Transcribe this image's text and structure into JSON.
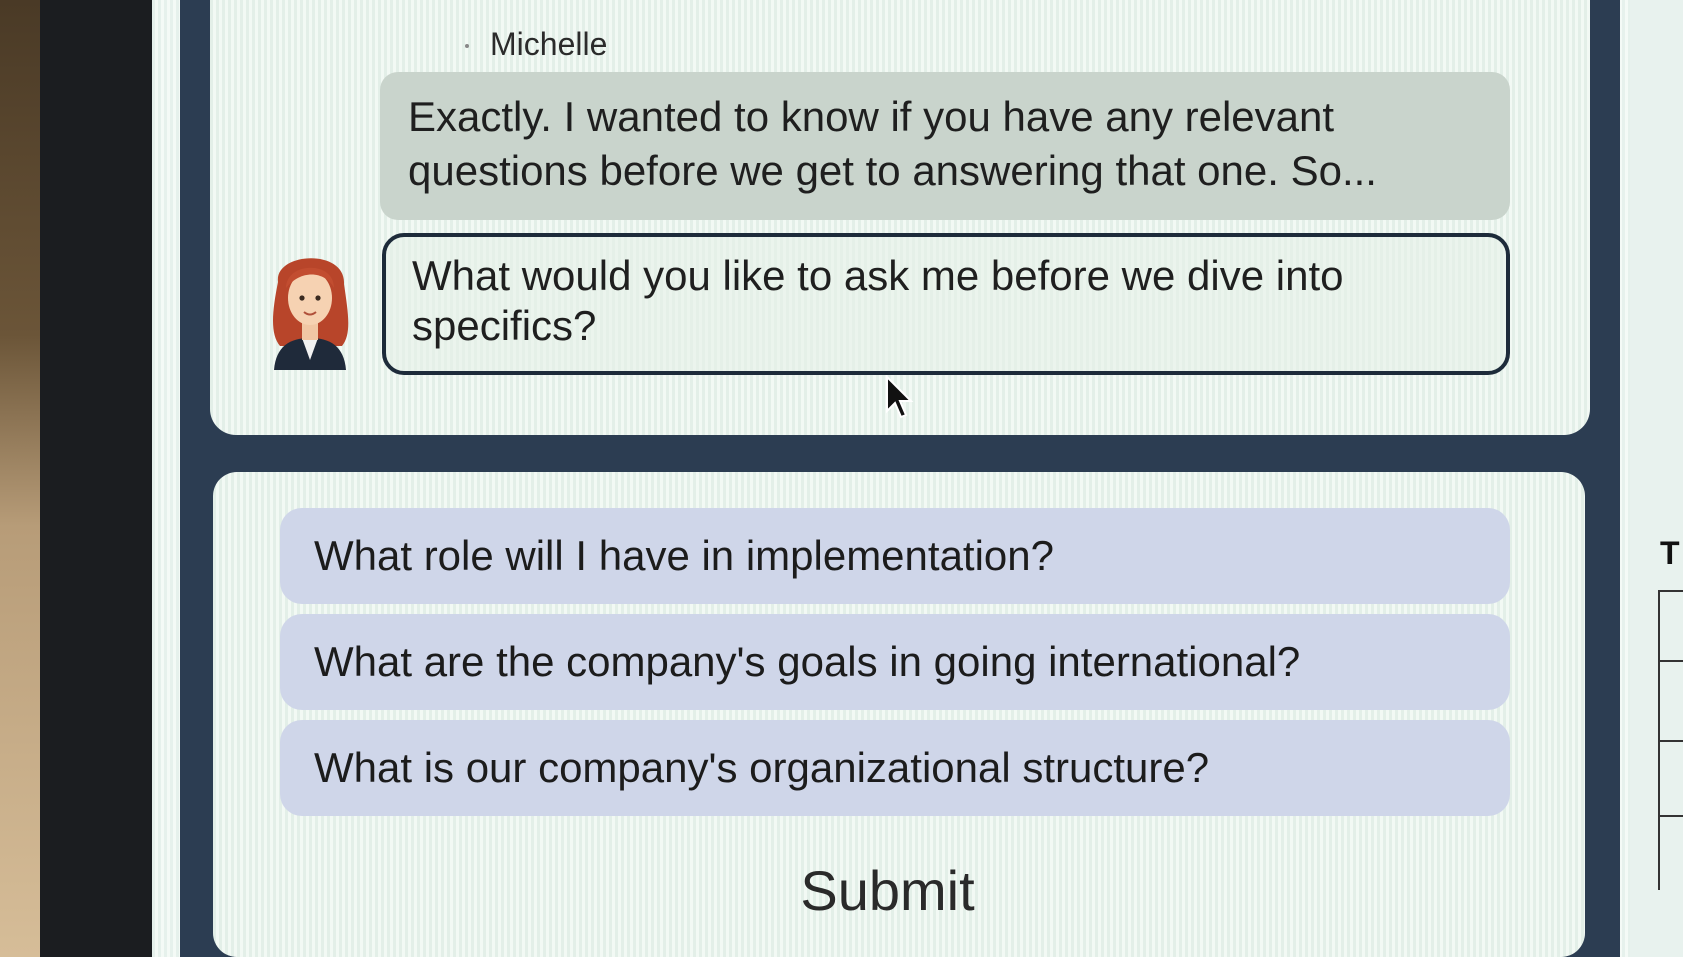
{
  "conversation": {
    "speaker_name": "Michelle",
    "message": "Exactly. I wanted to know if you have any relevant questions before we get to answering that one. So...",
    "prompt": "What would you like to ask me before we dive into specifics?",
    "avatar_icon": "woman-avatar-icon"
  },
  "options": [
    {
      "label": "What role will I have in implementation?"
    },
    {
      "label": "What are the company's goals in going international?"
    },
    {
      "label": "What is our company's organizational structure?"
    }
  ],
  "submit": {
    "label": "Submit"
  },
  "edge": {
    "glyph": "T"
  },
  "colors": {
    "panel_background": "#2c3d52",
    "card_background": "#eaf4ee",
    "message_bubble": "#c9d4cc",
    "option_background": "#cfd6e9",
    "prompt_border": "#1d2b3a"
  }
}
